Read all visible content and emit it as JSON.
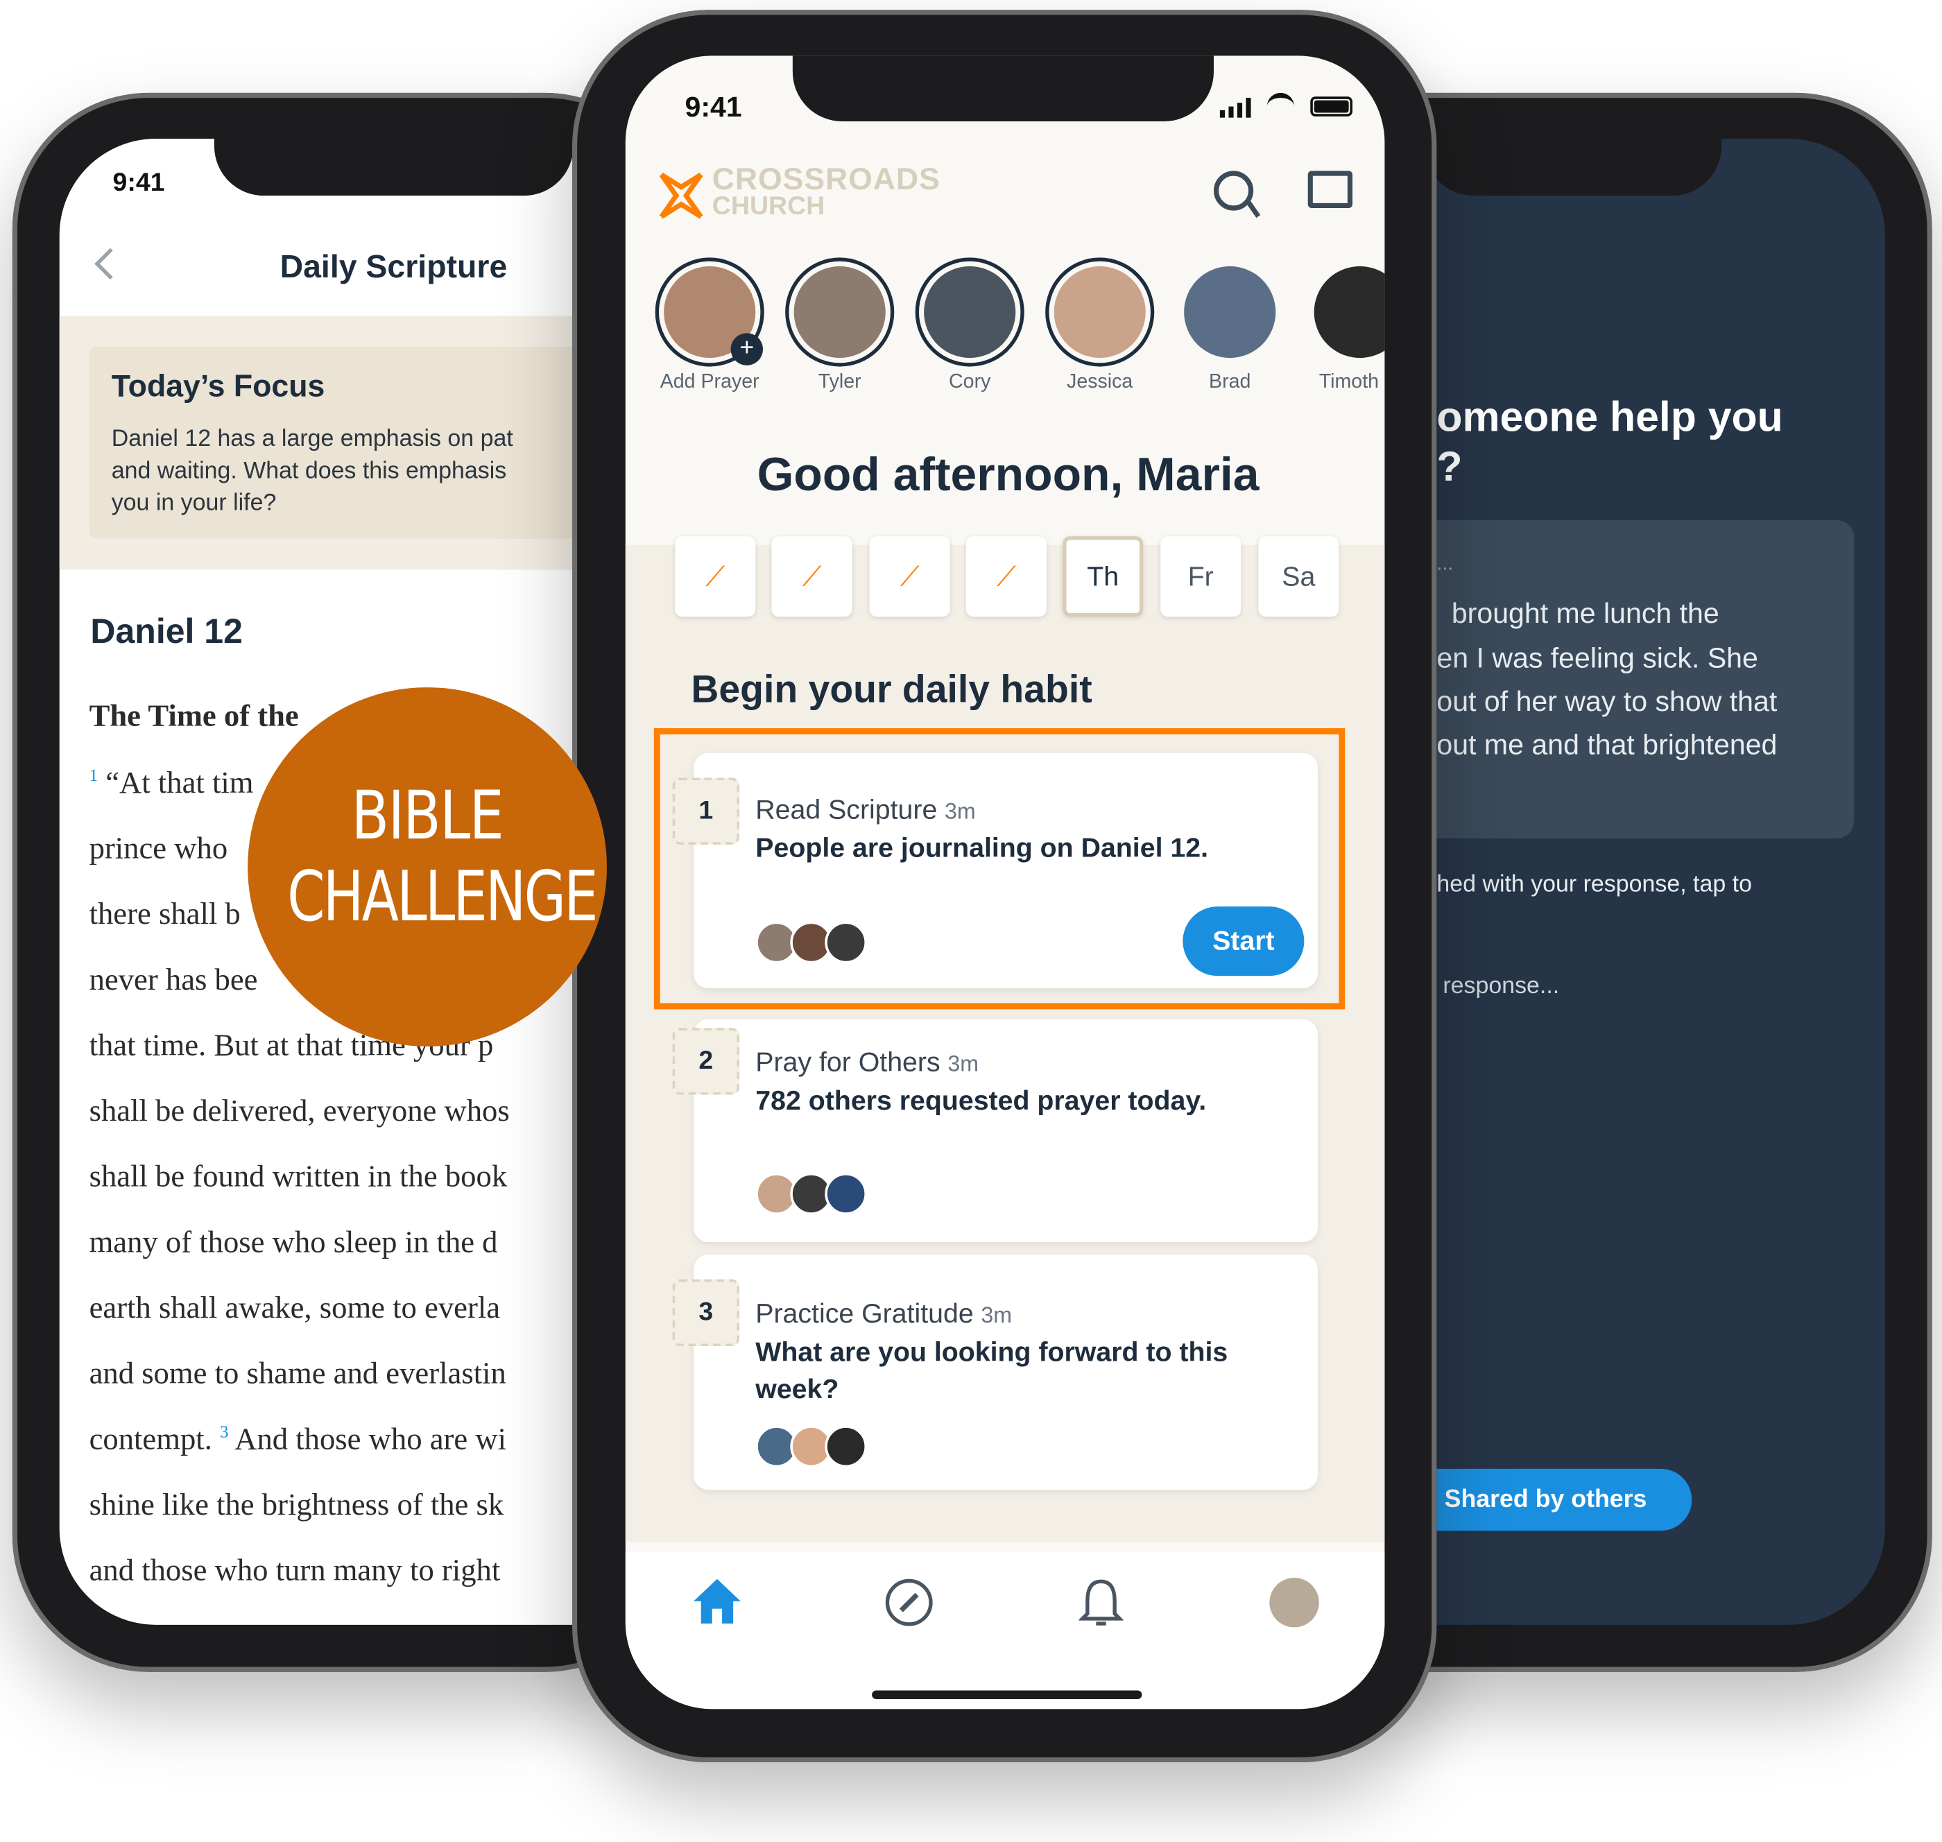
{
  "colors": {
    "accent": "#FF8000",
    "badge": "#C8660A",
    "primary_blue": "#1A8FE0",
    "navy": "#1E2D3D",
    "dark_bg": "#253447"
  },
  "left_phone": {
    "time": "9:41",
    "title": "Daily Scripture",
    "focus": {
      "heading": "Today’s Focus",
      "lines": [
        "Daniel 12 has a large emphasis on pat",
        "and waiting. What does this emphasis",
        "you in your life?"
      ]
    },
    "chapter": "Daniel 12",
    "section_heading": "The Time of the",
    "verse_lines": [
      {
        "sup": "1",
        "text": "“At that tim"
      },
      {
        "text": "prince who"
      },
      {
        "text": "there shall b"
      },
      {
        "text": "never has bee"
      },
      {
        "text": "that time. But at that time your p"
      },
      {
        "text": "shall be delivered, everyone whos"
      },
      {
        "text": "shall be found written in the book"
      },
      {
        "text": "many of those who sleep in the d"
      },
      {
        "text": "earth shall awake, some to everla"
      },
      {
        "text": "and some to shame and everlastin"
      },
      {
        "text": "contempt.",
        "sup": "3",
        "after": "And those who are wi"
      },
      {
        "text": "shine like the brightness of the sk"
      },
      {
        "text": "and those who turn many to right"
      }
    ]
  },
  "badge": {
    "line1": "BIBLE",
    "line2": "CHALLENGE"
  },
  "center_phone": {
    "time": "9:41",
    "logo": {
      "line1": "CROSSROADS",
      "line2": "CHURCH"
    },
    "icons": [
      "search-icon",
      "chat-icon"
    ],
    "stories": [
      {
        "name": "Add Prayer",
        "color": "#b08870"
      },
      {
        "name": "Tyler",
        "color": "#8c7b6e"
      },
      {
        "name": "Cory",
        "color": "#4a5560"
      },
      {
        "name": "Jessica",
        "color": "#c9a48a"
      },
      {
        "name": "Brad",
        "color": "#5a6e88"
      },
      {
        "name": "Timoth",
        "color": "#2a2a2a"
      }
    ],
    "greeting": "Good afternoon, Maria",
    "days": [
      {
        "label": "",
        "done": true
      },
      {
        "label": "",
        "done": true
      },
      {
        "label": "",
        "done": true
      },
      {
        "label": "",
        "done": true
      },
      {
        "label": "Th",
        "current": true
      },
      {
        "label": "Fr"
      },
      {
        "label": "Sa"
      }
    ],
    "habit_heading": "Begin your daily habit",
    "habits": [
      {
        "num": "1",
        "title": "Read Scripture",
        "duration": "3m",
        "subtitle": "People are journaling on Daniel 12.",
        "button": "Start"
      },
      {
        "num": "2",
        "title": "Pray for Others",
        "duration": "3m",
        "subtitle": "782 others requested prayer today."
      },
      {
        "num": "3",
        "title": "Practice Gratitude",
        "duration": "3m",
        "subtitle": "What are you looking forward to this week?"
      }
    ],
    "tabbar": [
      "home-icon",
      "compass-icon",
      "bell-icon",
      "profile-avatar"
    ]
  },
  "right_phone": {
    "question_lines": [
      "omeone help you",
      "?"
    ],
    "response_lines": [
      "...",
      "brought me lunch the",
      "en I was feeling sick. She",
      "out of her way to show that",
      "out me and that brightened"
    ],
    "hint": "hed with your response, tap to",
    "placeholder": "response...",
    "button": "Shared by others"
  }
}
